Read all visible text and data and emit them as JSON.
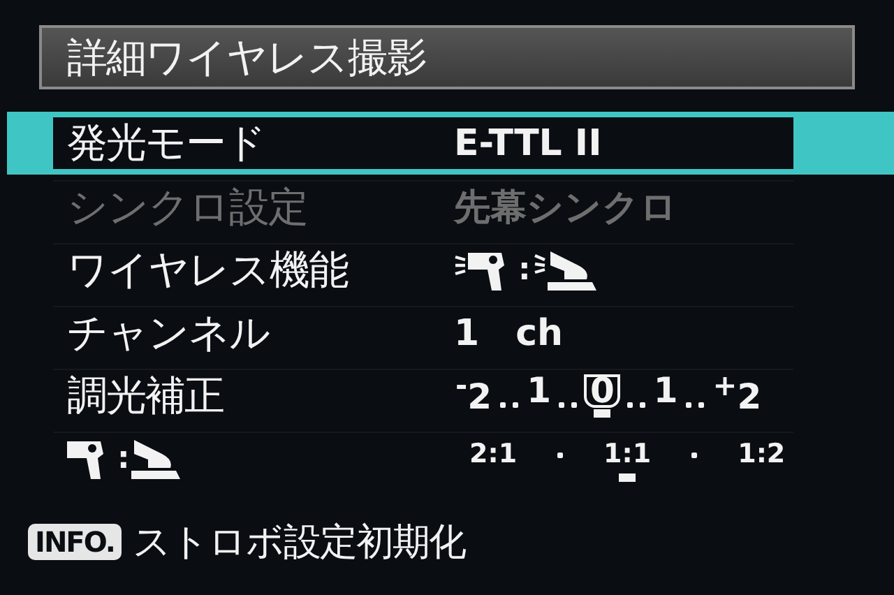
{
  "title": "詳細ワイヤレス撮影",
  "rows": [
    {
      "kind": "text",
      "label": "発光モード",
      "value": "E-TTL II",
      "selected": true,
      "disabled": false
    },
    {
      "kind": "text",
      "label": "シンクロ設定",
      "value": "先幕シンクロ",
      "selected": false,
      "disabled": true
    },
    {
      "kind": "wireless",
      "label": "ワイヤレス機能",
      "separator": ":",
      "selected": false,
      "disabled": false
    },
    {
      "kind": "text",
      "label": "チャンネル",
      "value": "1　ch",
      "selected": false,
      "disabled": false
    },
    {
      "kind": "scale",
      "label": "調光補正",
      "stops": [
        {
          "text": "$^{-}$2",
          "selected": false
        },
        {
          "text": "1",
          "selected": false
        },
        {
          "text": "0",
          "selected": true
        },
        {
          "text": "1",
          "selected": false
        },
        {
          "text": "$^{+}$2",
          "selected": false
        }
      ],
      "selected": false,
      "disabled": false
    },
    {
      "kind": "ratio",
      "separator": ":",
      "stops": [
        {
          "text": "2:1",
          "selected": false
        },
        {
          "text": "1:1",
          "selected": true
        },
        {
          "text": "1:2",
          "selected": false
        }
      ],
      "selected": false,
      "disabled": false
    }
  ],
  "footer": {
    "key": "INFO.",
    "label": "ストロボ設定初期化"
  }
}
